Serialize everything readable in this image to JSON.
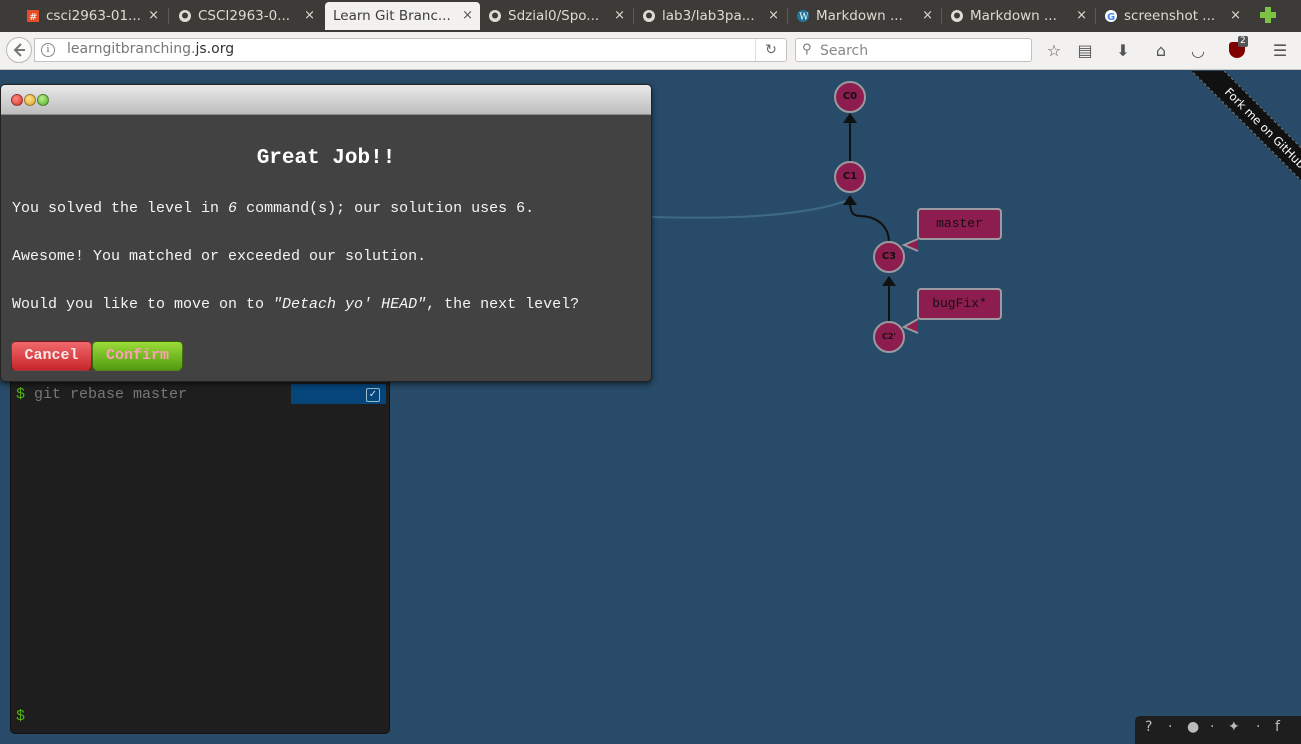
{
  "browser": {
    "tabs": [
      {
        "label": "csci2963-01...",
        "icon": "custom-favicon",
        "active": false
      },
      {
        "label": "CSCI2963-0...",
        "icon": "github-icon",
        "active": false
      },
      {
        "label": "Learn Git Branc...",
        "icon": "none",
        "active": true
      },
      {
        "label": "Sdzial0/Spo...",
        "icon": "github-icon",
        "active": false
      },
      {
        "label": "lab3/lab3pa...",
        "icon": "github-icon",
        "active": false
      },
      {
        "label": "Markdown ...",
        "icon": "wordpress-icon",
        "active": false
      },
      {
        "label": "Markdown ...",
        "icon": "github-icon",
        "active": false
      },
      {
        "label": "screenshot ...",
        "icon": "google-icon",
        "active": false
      }
    ],
    "close_glyph": "×",
    "url_prefix": "learngitbranching.",
    "url_domain": "js.org",
    "search_placeholder": "Search",
    "ublock_badge": "2"
  },
  "terminal": {
    "last_command": "git rebase master",
    "prompt": "$"
  },
  "graph": {
    "commits": [
      "C0",
      "C1",
      "C3",
      "C2'"
    ],
    "branches": [
      {
        "name": "master",
        "target": "C3"
      },
      {
        "name": "bugFix*",
        "target": "C2'"
      }
    ],
    "ribbon_text": "Fork me on GitHub",
    "colors": {
      "node": "#8c1d4e",
      "background": "#274b68"
    }
  },
  "modal": {
    "heading": "Great Job!!",
    "line1_pre": "You solved the level in ",
    "line1_count": "6",
    "line1_post": " command(s); our solution uses 6.",
    "line2": "Awesome! You matched or exceeded our solution.",
    "line3_pre": "Would you like to move on to ",
    "line3_level": "\"Detach yo' HEAD\"",
    "line3_post": ", the next level?",
    "cancel_label": "Cancel",
    "confirm_label": "Confirm"
  },
  "footer": {
    "icons": [
      "help-icon",
      "globe-icon",
      "twitter-icon",
      "facebook-icon"
    ],
    "glyphs": [
      "?",
      "·",
      "●",
      "·",
      "✦",
      "·",
      "f"
    ]
  }
}
